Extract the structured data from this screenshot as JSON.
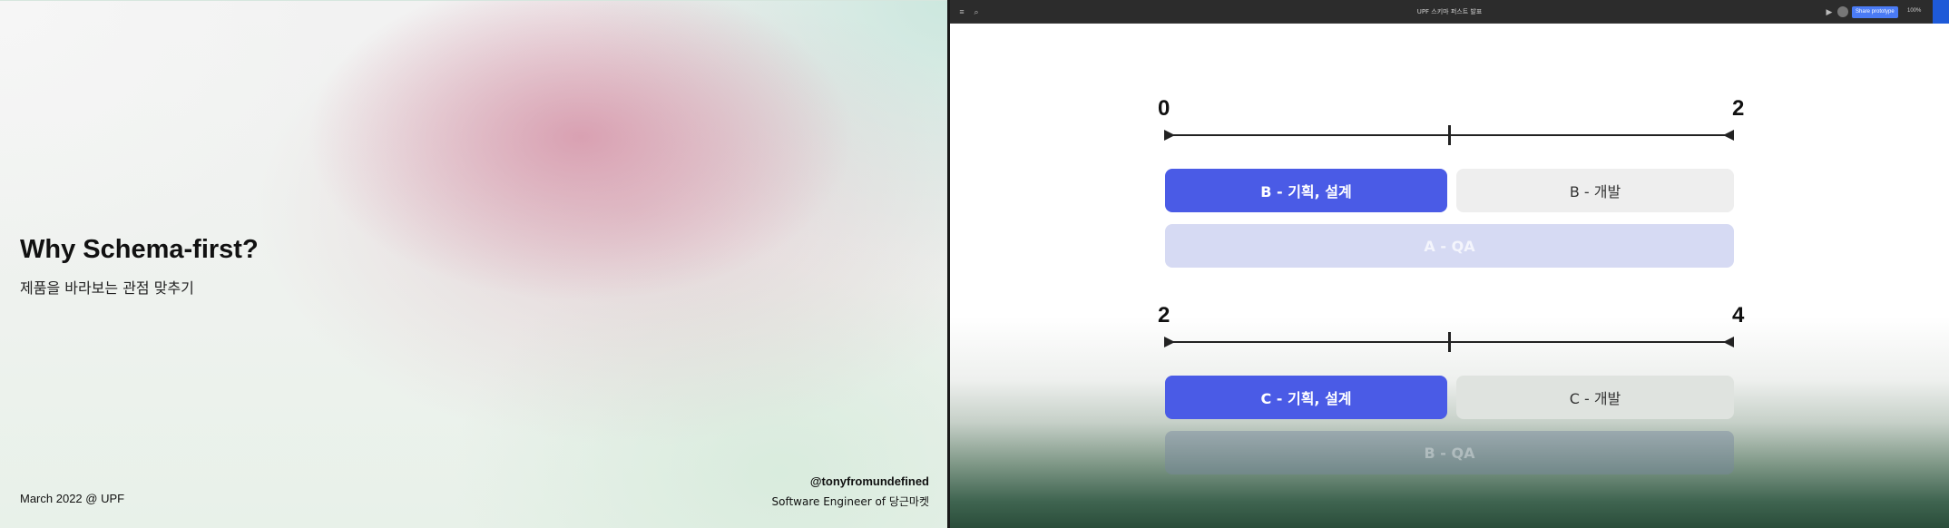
{
  "left_slide": {
    "title": "Why Schema-first?",
    "subtitle": "제품을 바라보는 관점 맞추기",
    "date": "March 2022 @ UPF",
    "author": "@tonyfromundefined",
    "role": "Software Engineer of 당근마켓"
  },
  "app": {
    "toolbar": {
      "title": "UPF 스키마 퍼스트 발표",
      "share_label": "Share prototype",
      "zoom": "100%"
    },
    "timeline_1": {
      "start": "0",
      "end": "2",
      "primary_label": "B - 기획, 설계",
      "secondary_label": "B - 개발",
      "faded_label": "A - QA"
    },
    "timeline_2": {
      "start": "2",
      "end": "4",
      "primary_label": "C - 기획, 설계",
      "secondary_label": "C - 개발",
      "faded_label": "B - QA"
    },
    "colors": {
      "primary_block": "#4a5be6",
      "secondary_block": "#eeeeee",
      "faded_block": "#d6daf3"
    }
  }
}
